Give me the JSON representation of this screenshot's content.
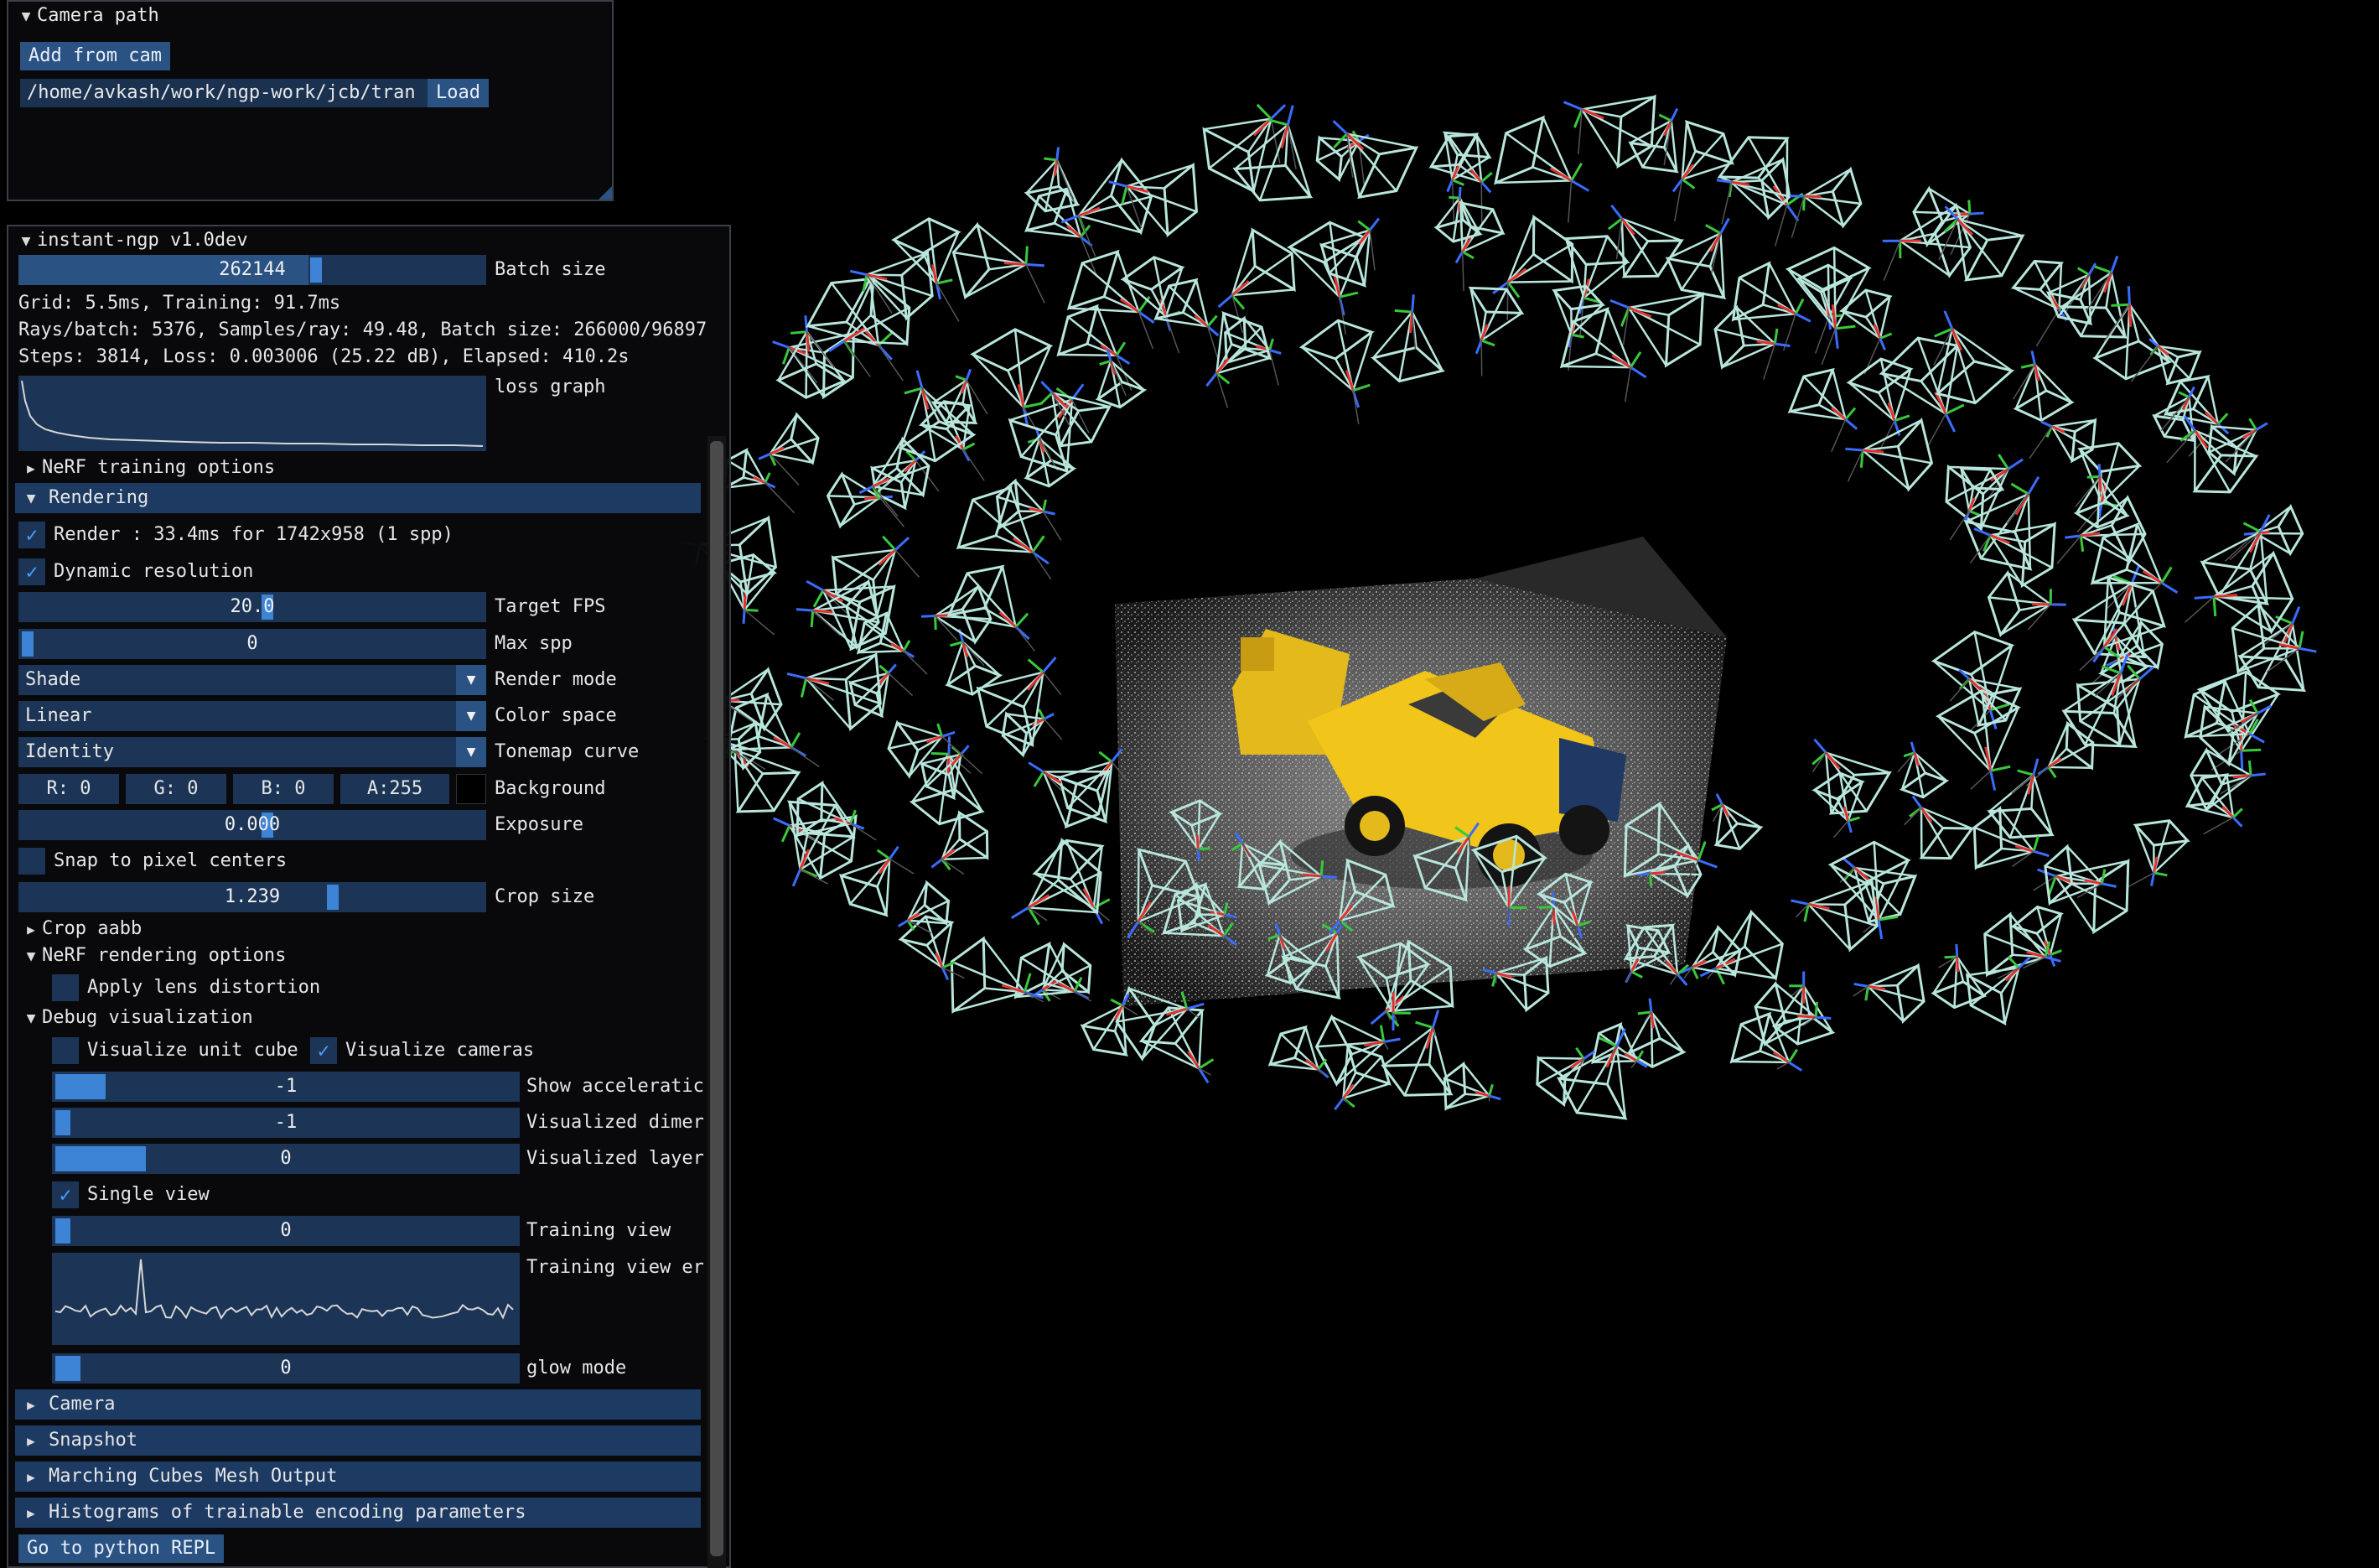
{
  "camera_path": {
    "title": "Camera path",
    "add_from_cam": "Add from cam",
    "path_value": "/home/avkash/work/ngp-work/jcb/tran",
    "load": "Load"
  },
  "main": {
    "title": "instant-ngp v1.0dev",
    "batch_size": {
      "value": "262144",
      "label": "Batch size",
      "fraction": 0.6
    },
    "stats": [
      "Grid: 5.5ms, Training: 91.7ms",
      "Rays/batch: 5376, Samples/ray: 49.48, Batch size: 266000/96897",
      "Steps: 3814, Loss: 0.003006 (25.22 dB), Elapsed: 410.2s"
    ],
    "loss_graph_label": "loss graph",
    "nerf_training_options": "NeRF training options",
    "rendering": "Rendering",
    "render_check": "Render : 33.4ms for 1742x958 (1 spp)",
    "dynamic_resolution": "Dynamic resolution",
    "target_fps": {
      "value": "20.0",
      "label": "Target FPS"
    },
    "max_spp": {
      "value": "0",
      "label": "Max spp"
    },
    "render_mode": {
      "value": "Shade",
      "label": "Render mode"
    },
    "color_space": {
      "value": "Linear",
      "label": "Color space"
    },
    "tonemap_curve": {
      "value": "Identity",
      "label": "Tonemap curve"
    },
    "background": {
      "r": "R: 0",
      "g": "G: 0",
      "b": "B: 0",
      "a": "A:255",
      "label": "Background",
      "color": "#000000"
    },
    "exposure": {
      "value": "0.000",
      "label": "Exposure"
    },
    "snap_to_pixel_centers": "Snap to pixel centers",
    "crop_size": {
      "value": "1.239",
      "label": "Crop size"
    },
    "crop_aabb": "Crop aabb",
    "nerf_rendering_options": "NeRF rendering options",
    "apply_lens_distortion": "Apply lens distortion",
    "debug_visualization": "Debug visualization",
    "visualize_unit_cube": "Visualize unit cube",
    "visualize_cameras": "Visualize cameras",
    "show_acceleration": {
      "value": "-1",
      "label": "Show acceleratic"
    },
    "visualized_dimension": {
      "value": "-1",
      "label": "Visualized dimer"
    },
    "visualized_layer": {
      "value": "0",
      "label": "Visualized layer"
    },
    "single_view": "Single view",
    "training_view": {
      "value": "0",
      "label": "Training view"
    },
    "training_view_error_label": "Training view er",
    "glow_mode": {
      "value": "0",
      "label": "glow mode"
    },
    "sections": [
      "Camera",
      "Snapshot",
      "Marching Cubes Mesh Output",
      "Histograms of trainable encoding parameters"
    ],
    "python_repl": "Go to python REPL"
  },
  "colors": {
    "accent": "#2a5384",
    "frame_bg": "#1c3556",
    "header_bg": "#1d3a63",
    "check": "#4a9cff",
    "camera_frustum": "#b8e6dc"
  }
}
